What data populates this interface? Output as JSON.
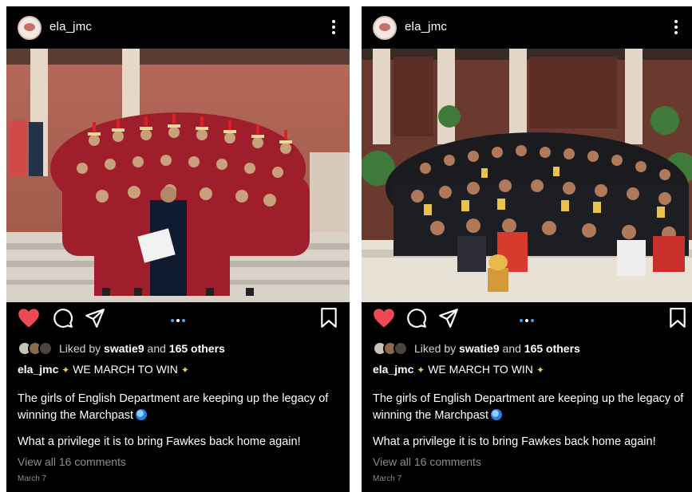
{
  "posts": [
    {
      "username": "ela_jmc",
      "liked_by_prefix": "Liked by",
      "liked_by_user": "swatie9",
      "liked_by_and": "and",
      "liked_by_others": "165 others",
      "caption_user": "ela_jmc",
      "caption_title": "WE MARCH TO WIN",
      "caption_body": "The girls of English Department are keeping up the legacy of winning the Marchpast",
      "caption_extra": "What a privilege it is to bring Fawkes back home again!",
      "view_comments": "View all 16 comments",
      "date": "March 7",
      "photo_icon": "group-marching-photo"
    },
    {
      "username": "ela_jmc",
      "liked_by_prefix": "Liked by",
      "liked_by_user": "swatie9",
      "liked_by_and": "and",
      "liked_by_others": "165 others",
      "caption_user": "ela_jmc",
      "caption_title": "WE MARCH TO WIN",
      "caption_body": "The girls of English Department are keeping up the legacy of winning the Marchpast",
      "caption_extra": "What a privilege it is to bring Fawkes back home again!",
      "view_comments": "View all 16 comments",
      "date": "March 7",
      "photo_icon": "group-trophy-photo"
    }
  ],
  "colors": {
    "background": "#000000",
    "like_red": "#ed4956",
    "carousel_blue": "#3aa7ff",
    "muted_text": "#8c8c8c"
  }
}
